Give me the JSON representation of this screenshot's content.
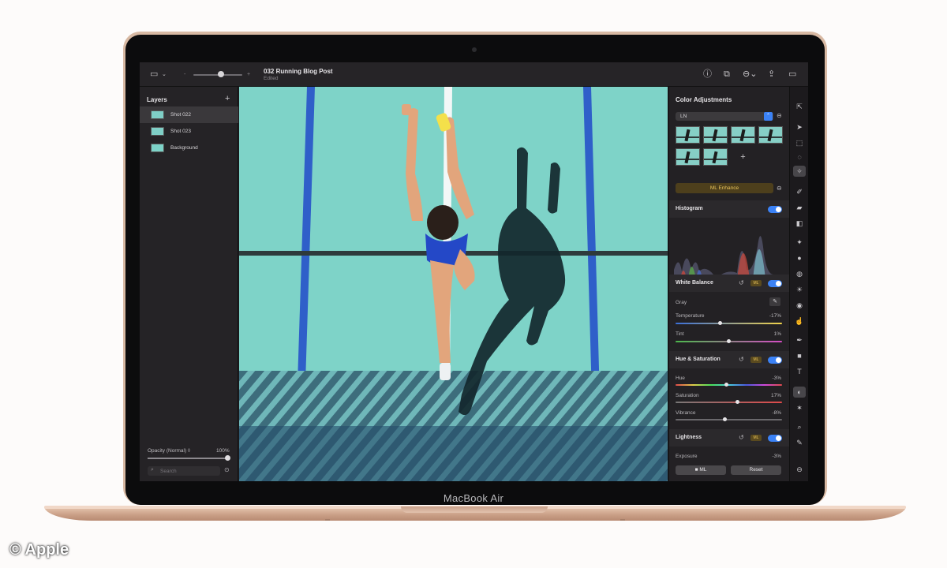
{
  "device": {
    "label": "MacBook Air"
  },
  "toolbar": {
    "doc_title": "032 Running Blog Post",
    "doc_status": "Edited",
    "icons": [
      "sidebar-icon",
      "chevron-down-icon",
      "zoom-slider",
      "info-icon",
      "share-icon",
      "more-icon",
      "export-icon",
      "panel-icon"
    ]
  },
  "layers": {
    "title": "Layers",
    "add_label": "+",
    "items": [
      {
        "name": "Shot 022",
        "selected": true
      },
      {
        "name": "Shot 023",
        "selected": false
      },
      {
        "name": "Background",
        "selected": false
      }
    ],
    "opacity_label": "Opacity (Normal) ◊",
    "opacity_value": "100%",
    "search_placeholder": "Search"
  },
  "adjustments": {
    "title": "Color Adjustments",
    "preset": "LN",
    "add_thumb_label": "+",
    "ml_enhance_label": "ML Enhance",
    "histogram": {
      "title": "Histogram",
      "enabled": true
    },
    "white_balance": {
      "title": "White Balance",
      "ml_badge": "ML",
      "enabled": true,
      "gray_label": "Gray",
      "temperature_label": "Temperature",
      "temperature_value": "-17%",
      "temperature_level": 0.42,
      "tint_label": "Tint",
      "tint_value": "1%",
      "tint_level": 0.5
    },
    "hue_saturation": {
      "title": "Hue & Saturation",
      "ml_badge": "ML",
      "enabled": true,
      "hue_label": "Hue",
      "hue_value": "-3%",
      "hue_level": 0.48,
      "saturation_label": "Saturation",
      "saturation_value": "17%",
      "saturation_level": 0.58,
      "vibrance_label": "Vibrance",
      "vibrance_value": "-8%",
      "vibrance_level": 0.46
    },
    "lightness": {
      "title": "Lightness",
      "ml_badge": "ML",
      "enabled": true,
      "exposure_label": "Exposure",
      "exposure_value": "-3%"
    },
    "buttons": {
      "ml": "■ ML",
      "reset": "Reset"
    }
  },
  "colors": {
    "accent": "#3b82f6",
    "ml_gold": "#e8c35a",
    "track_teal": "#7dd3c8",
    "lane_blue": "#2f5fc9"
  },
  "watermark": "© Apple"
}
